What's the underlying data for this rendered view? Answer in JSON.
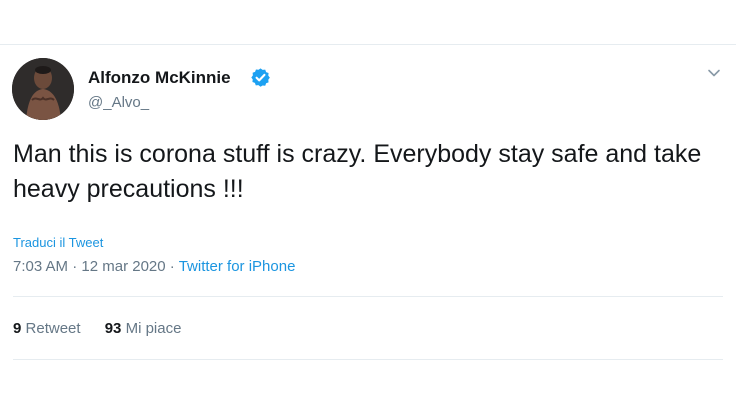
{
  "tweet": {
    "author_name": "Alfonzo McKinnie",
    "handle": "@_Alvo_",
    "text": "Man this is corona stuff is crazy. Everybody stay safe and take heavy precautions !!!",
    "translate_label": "Traduci il Tweet",
    "time": "7:03 AM",
    "date": "12 mar 2020",
    "source": "Twitter for iPhone",
    "separator": "·",
    "retweet_count": "9",
    "retweet_label": "Retweet",
    "like_count": "93",
    "like_label": "Mi piace"
  },
  "icons": {
    "verified": "verified-badge-icon",
    "caret": "chevron-down-icon",
    "avatar": "profile-photo"
  },
  "colors": {
    "link": "#1b95e0",
    "muted": "#657786",
    "text": "#14171a",
    "divider": "#e6ecf0"
  }
}
